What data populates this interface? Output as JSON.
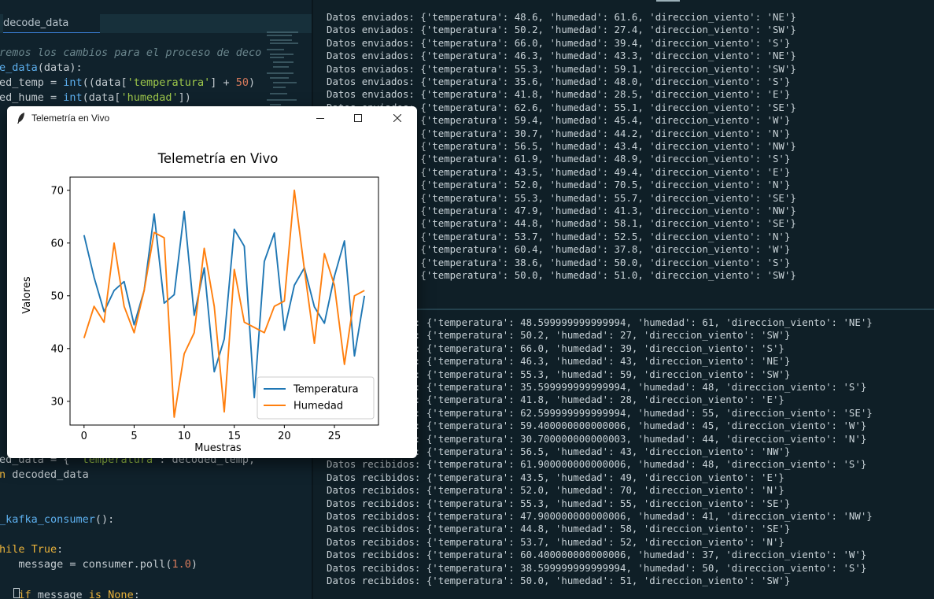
{
  "editor": {
    "tab_label": "decode_data",
    "lines": [
      [
        [
          "c",
          "remos los cambios para el proceso de deco"
        ]
      ],
      [
        [
          "f",
          "e_data"
        ],
        [
          "o",
          "(data):"
        ]
      ],
      [
        [
          "o",
          "ed_temp = "
        ],
        [
          "f",
          "int"
        ],
        [
          "o",
          "((data["
        ],
        [
          "s",
          "'temperatura'"
        ],
        [
          "o",
          "] + "
        ],
        [
          "n",
          "50"
        ],
        [
          "o",
          ")"
        ]
      ],
      [
        [
          "o",
          "ed_hume = "
        ],
        [
          "f",
          "int"
        ],
        [
          "o",
          "(data["
        ],
        [
          "s",
          "'humedad'"
        ],
        [
          "o",
          "])"
        ]
      ],
      [
        [
          "o",
          "ed_data = { "
        ],
        [
          "s",
          "'temperatura'"
        ],
        [
          "o",
          ": decoded_temp,"
        ]
      ],
      [
        [
          "k",
          "n"
        ],
        [
          "o",
          " decoded_data"
        ]
      ],
      [
        [
          "f",
          "_kafka_consumer"
        ],
        [
          "o",
          "():"
        ]
      ],
      [
        [
          "k",
          "hile True"
        ],
        [
          "o",
          ":"
        ]
      ],
      [
        [
          "o",
          "   message = consumer.poll("
        ],
        [
          "n",
          "1.0"
        ],
        [
          "o",
          ")"
        ]
      ],
      [
        [
          "k",
          "   if"
        ],
        [
          "o",
          " message "
        ],
        [
          "k",
          "is None"
        ],
        [
          "o",
          ":"
        ]
      ]
    ]
  },
  "terminal_top": {
    "lines": [
      "Datos enviados: {'temperatura': 48.6, 'humedad': 61.6, 'direccion_viento': 'NE'}",
      "Datos enviados: {'temperatura': 50.2, 'humedad': 27.4, 'direccion_viento': 'SW'}",
      "Datos enviados: {'temperatura': 66.0, 'humedad': 39.4, 'direccion_viento': 'S'}",
      "Datos enviados: {'temperatura': 46.3, 'humedad': 43.3, 'direccion_viento': 'NE'}",
      "Datos enviados: {'temperatura': 55.3, 'humedad': 59.1, 'direccion_viento': 'SW'}",
      "Datos enviados: {'temperatura': 35.6, 'humedad': 48.0, 'direccion_viento': 'S'}",
      "Datos enviados: {'temperatura': 41.8, 'humedad': 28.5, 'direccion_viento': 'E'}",
      "Datos enviados: {'temperatura': 62.6, 'humedad': 55.1, 'direccion_viento': 'SE'}",
      "Datos enviados: {'temperatura': 59.4, 'humedad': 45.4, 'direccion_viento': 'W'}",
      "Datos enviados: {'temperatura': 30.7, 'humedad': 44.2, 'direccion_viento': 'N'}",
      "Datos enviados: {'temperatura': 56.5, 'humedad': 43.4, 'direccion_viento': 'NW'}",
      "Datos enviados: {'temperatura': 61.9, 'humedad': 48.9, 'direccion_viento': 'S'}",
      "Datos enviados: {'temperatura': 43.5, 'humedad': 49.4, 'direccion_viento': 'E'}",
      "Datos enviados: {'temperatura': 52.0, 'humedad': 70.5, 'direccion_viento': 'N'}",
      "Datos enviados: {'temperatura': 55.3, 'humedad': 55.7, 'direccion_viento': 'SE'}",
      "Datos enviados: {'temperatura': 47.9, 'humedad': 41.3, 'direccion_viento': 'NW'}",
      "Datos enviados: {'temperatura': 44.8, 'humedad': 58.1, 'direccion_viento': 'SE'}",
      "Datos enviados: {'temperatura': 53.7, 'humedad': 52.5, 'direccion_viento': 'N'}",
      "Datos enviados: {'temperatura': 60.4, 'humedad': 37.8, 'direccion_viento': 'W'}",
      "Datos enviados: {'temperatura': 38.6, 'humedad': 50.0, 'direccion_viento': 'S'}",
      "Datos enviados: {'temperatura': 50.0, 'humedad': 51.0, 'direccion_viento': 'SW'}"
    ]
  },
  "terminal_bottom": {
    "lines": [
      "Datos recibidos: {'temperatura': 48.599999999999994, 'humedad': 61, 'direccion_viento': 'NE'}",
      "Datos recibidos: {'temperatura': 50.2, 'humedad': 27, 'direccion_viento': 'SW'}",
      "Datos recibidos: {'temperatura': 66.0, 'humedad': 39, 'direccion_viento': 'S'}",
      "Datos recibidos: {'temperatura': 46.3, 'humedad': 43, 'direccion_viento': 'NE'}",
      "Datos recibidos: {'temperatura': 55.3, 'humedad': 59, 'direccion_viento': 'SW'}",
      "Datos recibidos: {'temperatura': 35.599999999999994, 'humedad': 48, 'direccion_viento': 'S'}",
      "Datos recibidos: {'temperatura': 41.8, 'humedad': 28, 'direccion_viento': 'E'}",
      "Datos recibidos: {'temperatura': 62.599999999999994, 'humedad': 55, 'direccion_viento': 'SE'}",
      "Datos recibidos: {'temperatura': 59.400000000000006, 'humedad': 45, 'direccion_viento': 'W'}",
      "Datos recibidos: {'temperatura': 30.700000000000003, 'humedad': 44, 'direccion_viento': 'N'}",
      "Datos recibidos: {'temperatura': 56.5, 'humedad': 43, 'direccion_viento': 'NW'}",
      "Datos recibidos: {'temperatura': 61.900000000000006, 'humedad': 48, 'direccion_viento': 'S'}",
      "Datos recibidos: {'temperatura': 43.5, 'humedad': 49, 'direccion_viento': 'E'}",
      "Datos recibidos: {'temperatura': 52.0, 'humedad': 70, 'direccion_viento': 'N'}",
      "Datos recibidos: {'temperatura': 55.3, 'humedad': 55, 'direccion_viento': 'SE'}",
      "Datos recibidos: {'temperatura': 47.900000000000006, 'humedad': 41, 'direccion_viento': 'NW'}",
      "Datos recibidos: {'temperatura': 44.8, 'humedad': 58, 'direccion_viento': 'SE'}",
      "Datos recibidos: {'temperatura': 53.7, 'humedad': 52, 'direccion_viento': 'N'}",
      "Datos recibidos: {'temperatura': 60.400000000000006, 'humedad': 37, 'direccion_viento': 'W'}",
      "Datos recibidos: {'temperatura': 38.599999999999994, 'humedad': 50, 'direccion_viento': 'S'}",
      "Datos recibidos: {'temperatura': 50.0, 'humedad': 51, 'direccion_viento': 'SW'}"
    ]
  },
  "plot_window": {
    "title": "Telemetría en Vivo",
    "icon": "feather-icon",
    "controls": {
      "minimize": "—",
      "maximize": "☐",
      "close": "✕"
    }
  },
  "chart_data": {
    "type": "line",
    "title": "Telemetría en Vivo",
    "xlabel": "Muestras",
    "ylabel": "Valores",
    "xlim": [
      -1.4,
      29.4
    ],
    "ylim": [
      25.5,
      72.5
    ],
    "x_ticks": [
      0,
      5,
      10,
      15,
      20,
      25
    ],
    "y_ticks": [
      30,
      40,
      50,
      60,
      70
    ],
    "legend_position": "lower-right",
    "grid": false,
    "x": [
      0,
      1,
      2,
      3,
      4,
      5,
      6,
      7,
      8,
      9,
      10,
      11,
      12,
      13,
      14,
      15,
      16,
      17,
      18,
      19,
      20,
      21,
      22,
      23,
      24,
      25,
      26,
      27,
      28
    ],
    "series": [
      {
        "name": "Temperatura",
        "color": "#1f77b4",
        "values": [
          61.5,
          53.5,
          47,
          51,
          52.7,
          44.5,
          51,
          65.5,
          48.6,
          50.2,
          66,
          46.3,
          55.3,
          35.6,
          41.8,
          62.6,
          59.4,
          30.7,
          56.5,
          61.9,
          43.5,
          52,
          55.3,
          47.9,
          44.8,
          53.7,
          60.4,
          38.6,
          50
        ]
      },
      {
        "name": "Humedad",
        "color": "#ff7f0e",
        "values": [
          42,
          48,
          45,
          60,
          48,
          43,
          51,
          62,
          61,
          27,
          39,
          43,
          59,
          48,
          28,
          55,
          45,
          44,
          43,
          48,
          49,
          70,
          55,
          41,
          58,
          52,
          37,
          50,
          51
        ]
      }
    ]
  }
}
